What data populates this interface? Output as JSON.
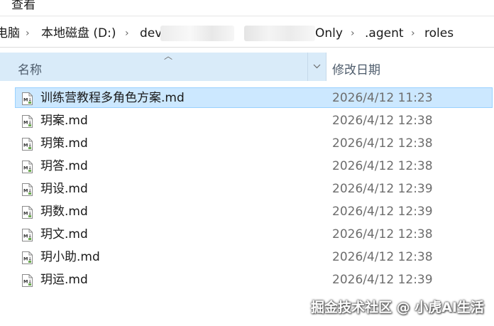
{
  "menu": {
    "view_label": "查看"
  },
  "address": {
    "crumbs": [
      "电脑",
      "本地磁盘 (D:)",
      "dev",
      "Only",
      ".agent",
      "roles"
    ]
  },
  "columns": {
    "name_label": "名称",
    "date_label": "修改日期"
  },
  "files": [
    {
      "name": "训练营教程多角色方案.md",
      "date": "2026/4/12 11:23",
      "selected": true
    },
    {
      "name": "玥案.md",
      "date": "2026/4/12 12:38"
    },
    {
      "name": "玥策.md",
      "date": "2026/4/12 12:38"
    },
    {
      "name": "玥答.md",
      "date": "2026/4/12 12:38"
    },
    {
      "name": "玥设.md",
      "date": "2026/4/12 12:39"
    },
    {
      "name": "玥数.md",
      "date": "2026/4/12 12:39"
    },
    {
      "name": "玥文.md",
      "date": "2026/4/12 12:38"
    },
    {
      "name": "玥小助.md",
      "date": "2026/4/12 12:38"
    },
    {
      "name": "玥运.md",
      "date": "2026/4/12 12:39"
    }
  ],
  "watermark": "掘金技术社区 @ 小虎AI生活",
  "icons": {
    "file_icon": "markdown-file-icon",
    "sort": "sort-ascending-icon",
    "dropdown": "chevron-down-icon",
    "separator": "chevron-right-icon"
  },
  "colors": {
    "selection_bg": "#cce8ff",
    "selection_border": "#99d1ff",
    "header_bg": "#d9ebf9",
    "date_text": "#6d6d6d"
  }
}
